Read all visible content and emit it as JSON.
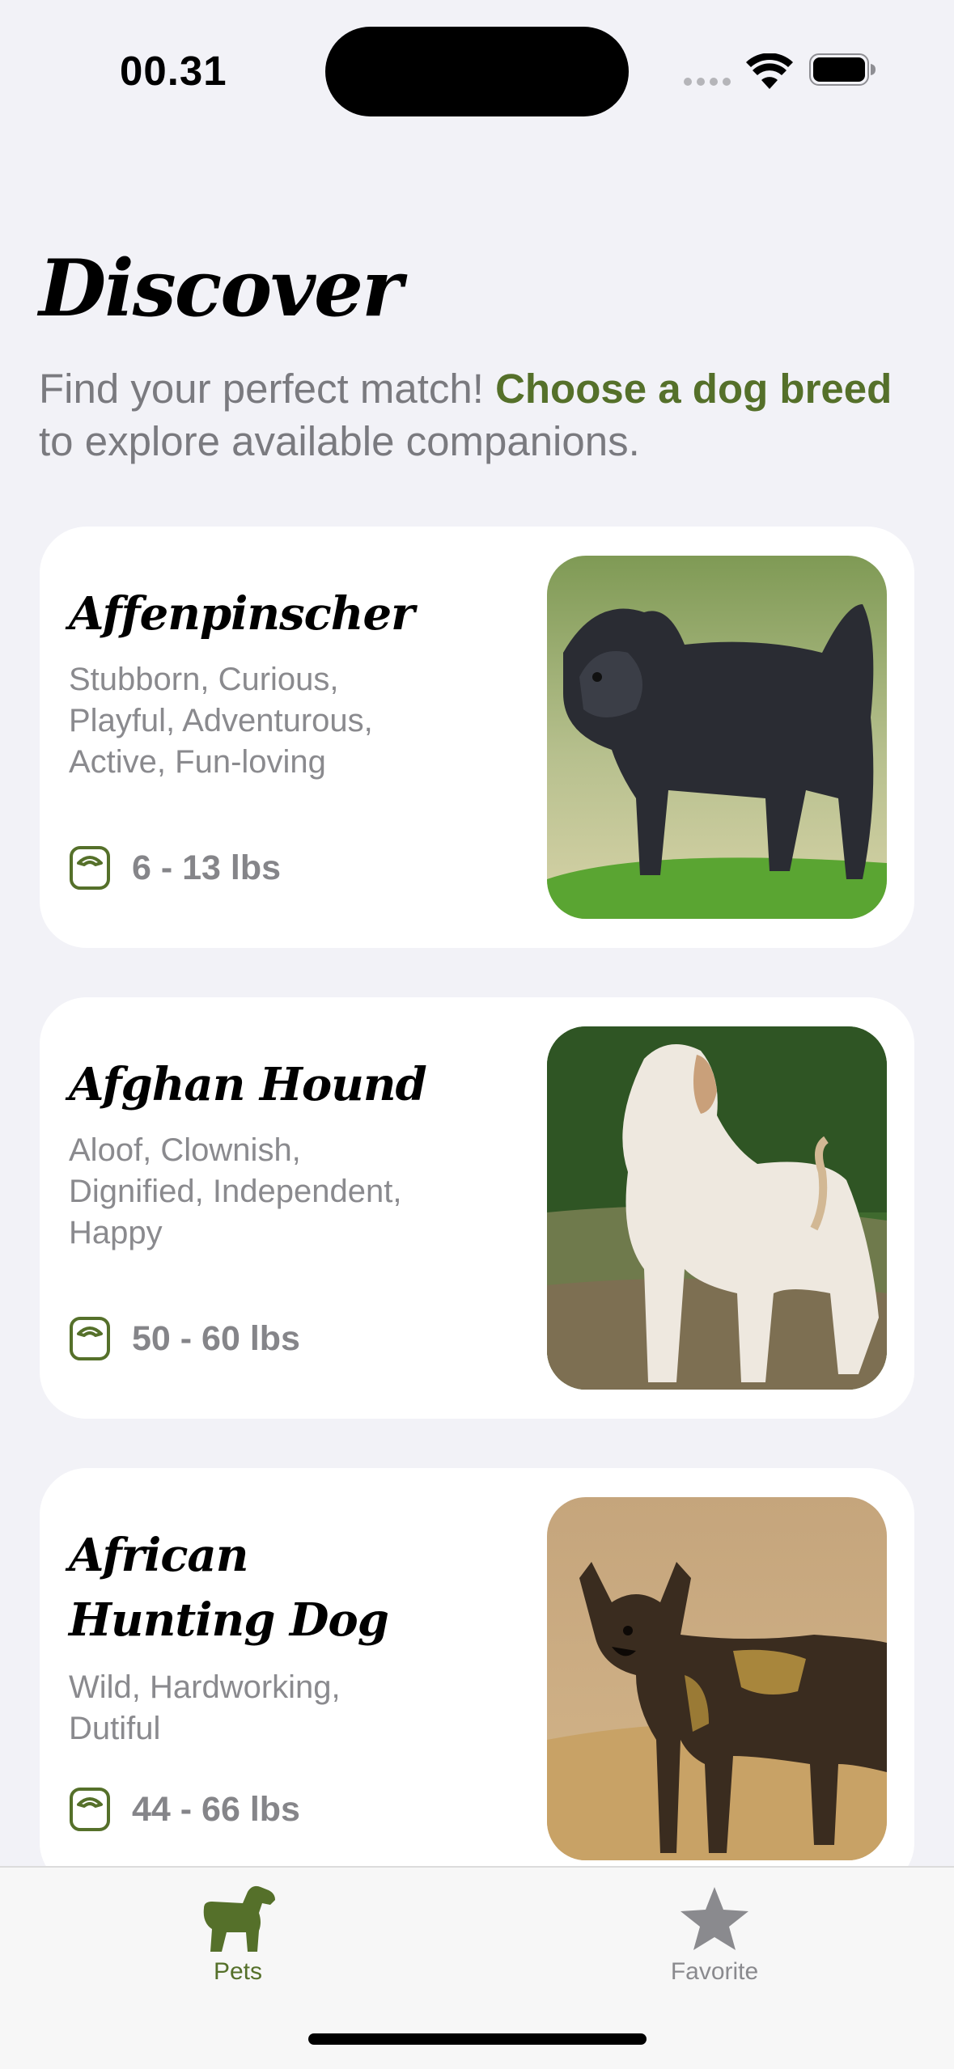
{
  "status_bar": {
    "time": "00.31"
  },
  "header": {
    "title": "Discover",
    "subtitle_pre": "Find your perfect match! ",
    "subtitle_highlight": "Choose a dog breed",
    "subtitle_post": " to explore available companions."
  },
  "breeds": [
    {
      "name_lines": [
        "Affenpinscher"
      ],
      "traits_lines": [
        "Stubborn, Curious,",
        "Playful, Adventurous,",
        "Active, Fun-loving"
      ],
      "weight": "6 - 13 lbs",
      "photo_icon": "black-shaggy-dog-photo"
    },
    {
      "name_lines": [
        "Afghan Hound"
      ],
      "traits_lines": [
        "Aloof, Clownish,",
        "Dignified, Independent,",
        "Happy"
      ],
      "weight": "50 - 60 lbs",
      "photo_icon": "afghan-hound-photo"
    },
    {
      "name_lines": [
        "African",
        "Hunting Dog"
      ],
      "traits_lines": [
        "Wild, Hardworking,",
        "Dutiful"
      ],
      "weight": "44 - 66 lbs",
      "photo_icon": "african-wild-dog-photo"
    }
  ],
  "tab_bar": {
    "tabs": [
      {
        "label": "Pets",
        "icon": "dog-icon",
        "active": true
      },
      {
        "label": "Favorite",
        "icon": "star-icon",
        "active": false
      }
    ]
  },
  "colors": {
    "accent": "#55702a",
    "inactive": "#8a8a8e",
    "background": "#f2f2f7"
  }
}
